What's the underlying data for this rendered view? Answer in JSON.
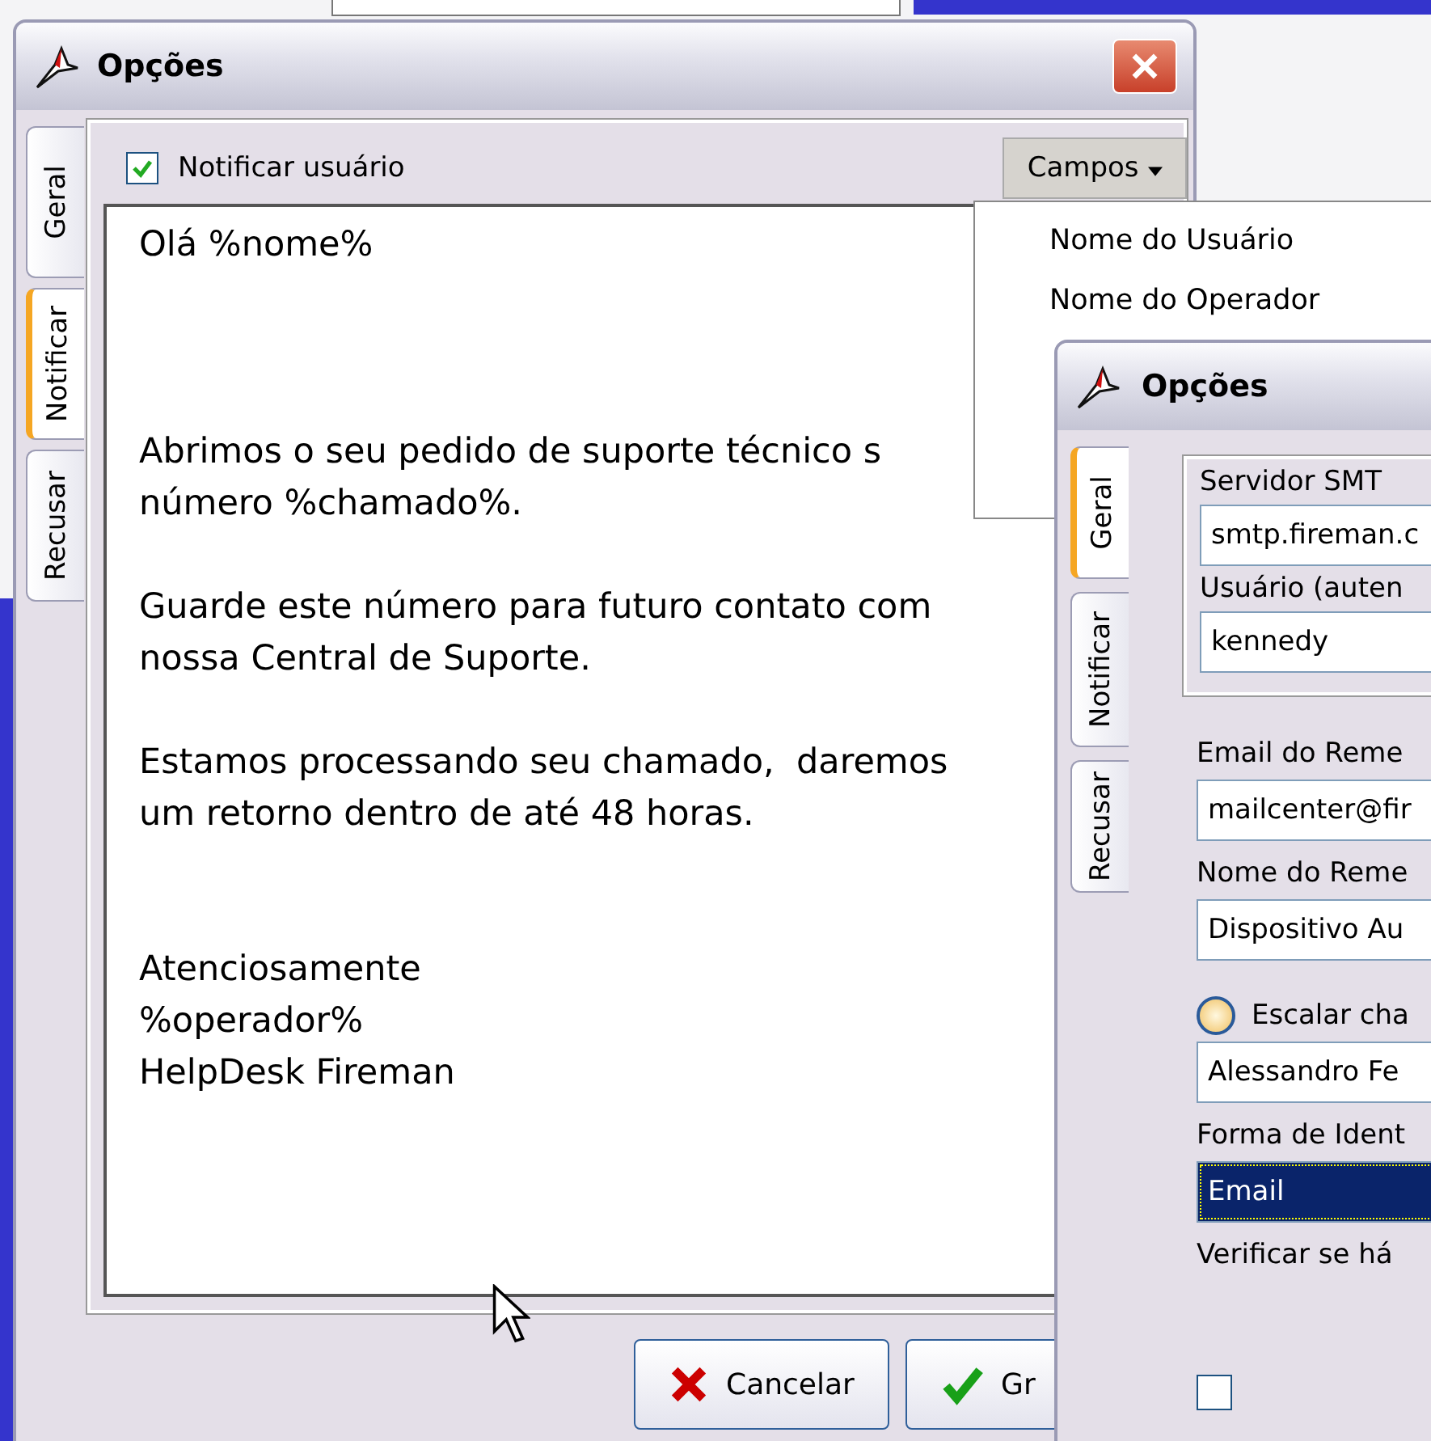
{
  "main_window": {
    "title": "Opções",
    "tabs": [
      {
        "label": "Geral",
        "selected": false
      },
      {
        "label": "Notificar",
        "selected": true
      },
      {
        "label": "Recusar",
        "selected": false
      }
    ],
    "notify_checkbox": {
      "label": "Notificar usuário",
      "checked": true
    },
    "fields_button": {
      "label": "Campos"
    },
    "message": {
      "value": "Olá %nome%\n\n\n\nAbrimos o seu pedido de suporte técnico s\nnúmero %chamado%.\n\nGuarde este número para futuro contato com\nnossa Central de Suporte.\n\nEstamos processando seu chamado,  daremos\num retorno dentro de até 48 horas.\n\n\nAtenciosamente\n%operador%\nHelpDesk Fireman"
    },
    "buttons": [
      {
        "label": "Cancelar",
        "kind": "cancel"
      },
      {
        "label": "Gr",
        "kind": "ok"
      }
    ]
  },
  "fields_menu": {
    "items": [
      {
        "label": "Nome do Usuário"
      },
      {
        "label": "Nome do Operador"
      }
    ]
  },
  "second_window": {
    "title": "Opções",
    "tabs": [
      {
        "label": "Geral",
        "selected": true
      },
      {
        "label": "Notificar",
        "selected": false
      },
      {
        "label": "Recusar",
        "selected": false
      }
    ],
    "group": [
      {
        "kind": "label",
        "text": "Servidor SMT"
      },
      {
        "kind": "input",
        "value": "smtp.fireman.c"
      },
      {
        "kind": "label",
        "text": "Usuário (auten"
      },
      {
        "kind": "input",
        "value": "kennedy"
      }
    ],
    "items": [
      {
        "kind": "label",
        "text": "Email do Reme"
      },
      {
        "kind": "input",
        "value": "mailcenter@fir"
      },
      {
        "kind": "label",
        "text": "Nome do Reme"
      },
      {
        "kind": "input",
        "value": "Dispositivo Au"
      },
      {
        "kind": "radio",
        "text": "Escalar cha",
        "selected": false
      },
      {
        "kind": "input",
        "value": "Alessandro Fe"
      },
      {
        "kind": "label",
        "text": "Forma de Ident"
      },
      {
        "kind": "select",
        "value": "Email",
        "highlighted": true
      },
      {
        "kind": "label",
        "text": "Verificar se há"
      },
      {
        "kind": "checkbox",
        "checked": false
      }
    ]
  }
}
